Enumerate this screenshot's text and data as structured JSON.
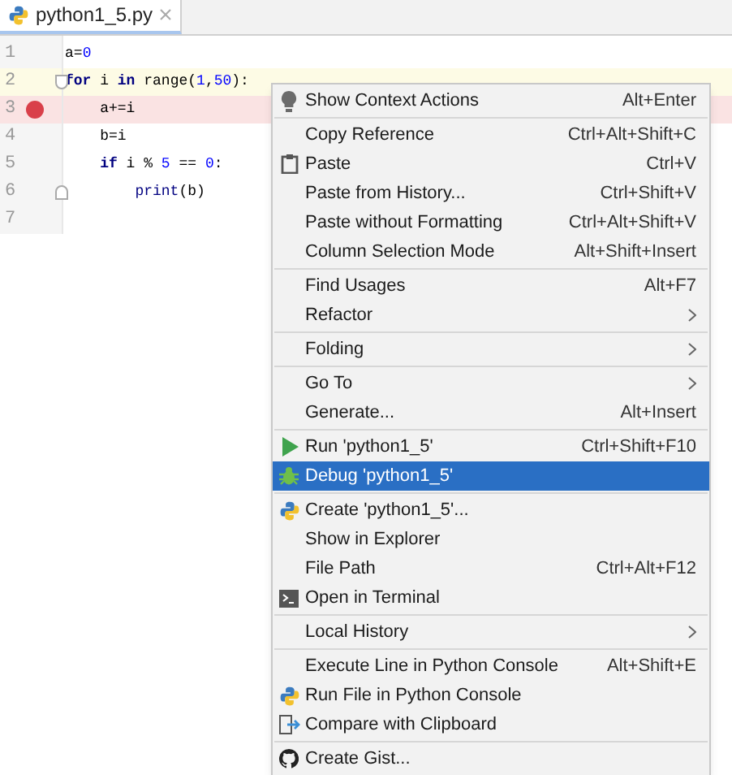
{
  "tabs": [
    {
      "label": "python1_5.py",
      "selected": true
    }
  ],
  "editor": {
    "lines": [
      {
        "number": "1",
        "kind": "plain",
        "tokens": [
          {
            "kind": "plain",
            "text": "a="
          },
          {
            "kind": "number",
            "text": "0"
          }
        ]
      },
      {
        "number": "2",
        "kind": "fold-start",
        "current": true,
        "tokens": [
          {
            "kind": "keyword",
            "text": "for"
          },
          {
            "kind": "plain",
            "text": " i "
          },
          {
            "kind": "keyword",
            "text": "in"
          },
          {
            "kind": "plain",
            "text": " range("
          },
          {
            "kind": "number",
            "text": "1"
          },
          {
            "kind": "plain",
            "text": ","
          },
          {
            "kind": "number",
            "text": "50"
          },
          {
            "kind": "plain",
            "text": "):"
          }
        ]
      },
      {
        "number": "3",
        "kind": "plain",
        "breakpoint": true,
        "tokens": [
          {
            "kind": "plain",
            "text": "    a+=i"
          }
        ]
      },
      {
        "number": "4",
        "kind": "plain",
        "tokens": [
          {
            "kind": "plain",
            "text": "    b=i"
          }
        ]
      },
      {
        "number": "5",
        "kind": "plain",
        "tokens": [
          {
            "kind": "keyword",
            "text": "    if"
          },
          {
            "kind": "plain",
            "text": " i % "
          },
          {
            "kind": "number",
            "text": "5"
          },
          {
            "kind": "plain",
            "text": " == "
          },
          {
            "kind": "number",
            "text": "0"
          },
          {
            "kind": "plain",
            "text": ":"
          }
        ]
      },
      {
        "number": "6",
        "kind": "fold-end",
        "tokens": [
          {
            "kind": "builtin",
            "text": "        print"
          },
          {
            "kind": "plain",
            "text": "(b)"
          }
        ]
      },
      {
        "number": "7",
        "kind": "plain"
      }
    ]
  },
  "context_menu": {
    "groups": [
      [
        {
          "kind": "bulb",
          "label": "Show Context Actions",
          "shortcut": "Alt+Enter",
          "selected": false
        }
      ],
      [
        {
          "kind": "text",
          "label": "Copy Reference",
          "shortcut": "Ctrl+Alt+Shift+C",
          "selected": false
        },
        {
          "kind": "clipboard",
          "label": "Paste",
          "shortcut": "Ctrl+V",
          "selected": false
        },
        {
          "kind": "text",
          "label": "Paste from History...",
          "shortcut": "Ctrl+Shift+V",
          "selected": false
        },
        {
          "kind": "text",
          "label": "Paste without Formatting",
          "shortcut": "Ctrl+Alt+Shift+V",
          "selected": false
        },
        {
          "kind": "text",
          "label": "Column Selection Mode",
          "shortcut": "Alt+Shift+Insert",
          "selected": false
        }
      ],
      [
        {
          "kind": "text",
          "label": "Find Usages",
          "shortcut": "Alt+F7",
          "selected": false
        },
        {
          "kind": "text",
          "label": "Refactor",
          "submenu": true,
          "selected": false
        }
      ],
      [
        {
          "kind": "text",
          "label": "Folding",
          "submenu": true,
          "selected": false
        }
      ],
      [
        {
          "kind": "text",
          "label": "Go To",
          "submenu": true,
          "selected": false
        },
        {
          "kind": "text",
          "label": "Generate...",
          "shortcut": "Alt+Insert",
          "selected": false
        }
      ],
      [
        {
          "kind": "play",
          "label": "Run 'python1_5'",
          "shortcut": "Ctrl+Shift+F10",
          "selected": false
        },
        {
          "kind": "bug",
          "label": "Debug 'python1_5'",
          "selected": true
        }
      ],
      [
        {
          "kind": "python",
          "label": "Create 'python1_5'...",
          "selected": false
        },
        {
          "kind": "text",
          "label": "Show in Explorer",
          "selected": false
        },
        {
          "kind": "text",
          "label": "File Path",
          "shortcut": "Ctrl+Alt+F12",
          "selected": false
        },
        {
          "kind": "terminal",
          "label": "Open in Terminal",
          "selected": false
        }
      ],
      [
        {
          "kind": "text",
          "label": "Local History",
          "submenu": true,
          "selected": false
        }
      ],
      [
        {
          "kind": "text",
          "label": "Execute Line in Python Console",
          "shortcut": "Alt+Shift+E",
          "selected": false
        },
        {
          "kind": "python",
          "label": "Run File in Python Console",
          "selected": false
        },
        {
          "kind": "compare",
          "label": "Compare with Clipboard",
          "selected": false
        }
      ],
      [
        {
          "kind": "github",
          "label": "Create Gist...",
          "selected": false
        }
      ]
    ]
  }
}
